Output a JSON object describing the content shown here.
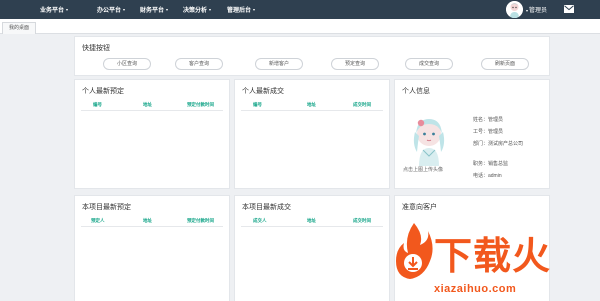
{
  "nav": {
    "items": [
      {
        "label": "业务平台"
      },
      {
        "label": "办公平台"
      },
      {
        "label": "财务平台"
      },
      {
        "label": "决策分析"
      },
      {
        "label": "管理后台"
      }
    ],
    "caret": "▾",
    "user": "管理员"
  },
  "tabs": {
    "home": "我的桌面"
  },
  "quick": {
    "title": "快捷按钮",
    "buttons": [
      {
        "label": "小区查询"
      },
      {
        "label": "客户查询"
      },
      {
        "label": "新增客户"
      },
      {
        "label": "预定查询"
      },
      {
        "label": "成交查询"
      },
      {
        "label": "刷新页面"
      }
    ]
  },
  "personal_reserve": {
    "title": "个人最新预定",
    "columns": [
      "编号",
      "地址",
      "预定付款时间"
    ]
  },
  "personal_deal": {
    "title": "个人最新成交",
    "columns": [
      "编号",
      "地址",
      "成交时间"
    ]
  },
  "personal_info": {
    "title": "个人信息",
    "avatar_caption": "点击上图上传头像",
    "fields": [
      {
        "text": "姓名：管理员"
      },
      {
        "text": "工号：管理员"
      },
      {
        "text": "部门：测试房产总公司"
      },
      {
        "text": "职务：销售总监"
      },
      {
        "text": "电话：admin"
      }
    ]
  },
  "project_reserve": {
    "title": "本项目最新预定",
    "columns": [
      "预定人",
      "地址",
      "预定付款时间"
    ]
  },
  "project_deal": {
    "title": "本项目最新成交",
    "columns": [
      "成交人",
      "地址",
      "成交时间"
    ]
  },
  "prospects": {
    "title": "准意向客户"
  },
  "watermark": {
    "logo": "下载火",
    "domain": "xiazaihuo.com"
  },
  "colors": {
    "nav_bg": "#2f4050",
    "accent": "#15a589",
    "watermark": "#f2581d"
  }
}
